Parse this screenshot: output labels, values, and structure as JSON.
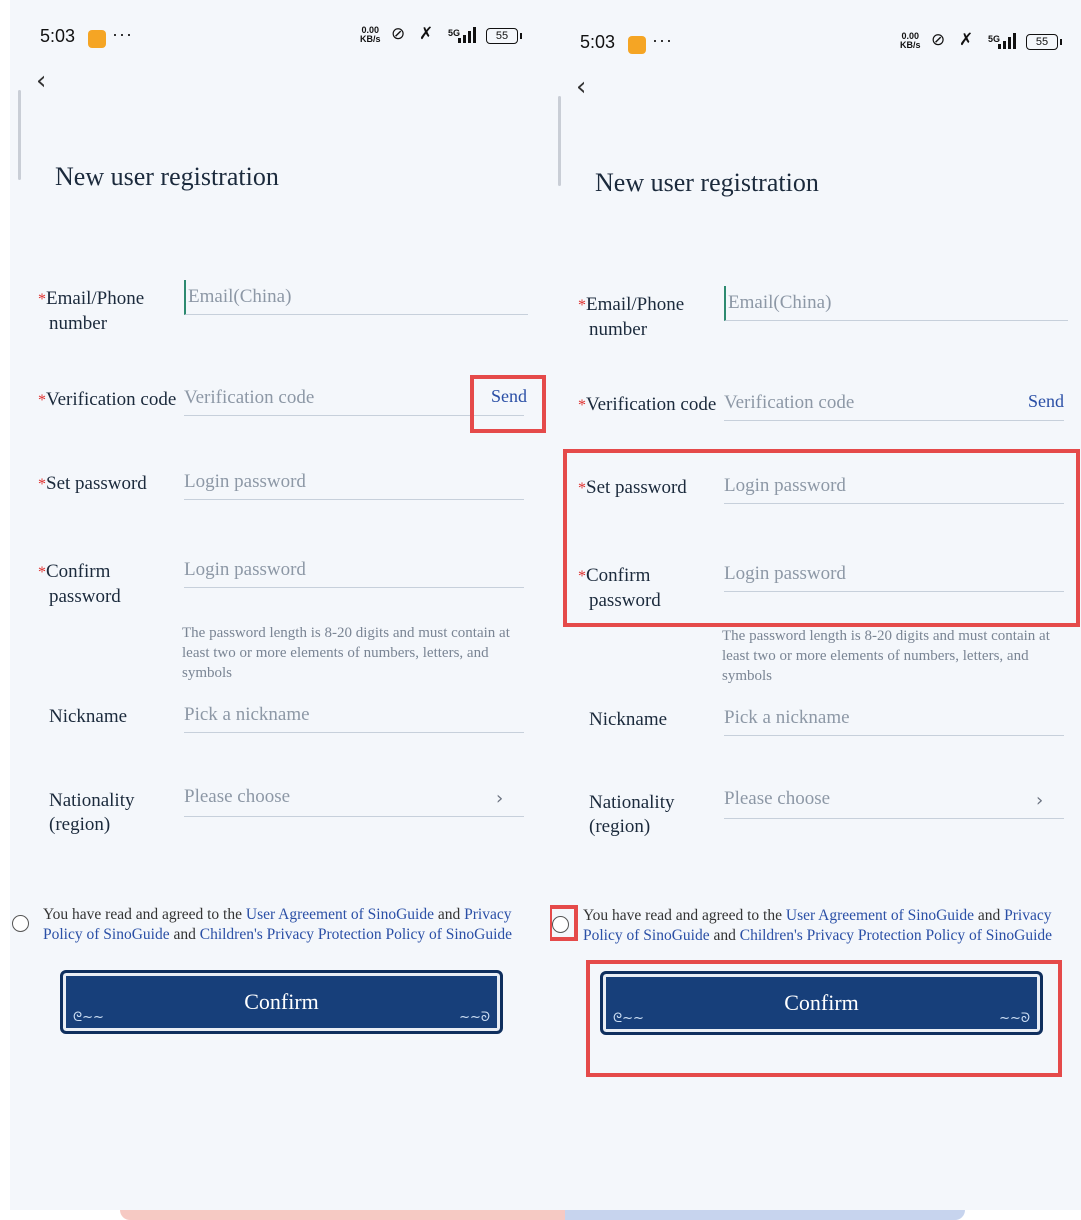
{
  "status_bar": {
    "time": "5:03",
    "dots": "···",
    "net_speed_value": "0.00",
    "net_speed_unit": "KB/s",
    "network": "5G",
    "battery": "55"
  },
  "page": {
    "title": "New user registration",
    "required_marker": "*",
    "email_label_1": "Email/Phone",
    "email_label_2": "number",
    "email_placeholder": "Email(China)",
    "code_label": "Verification code",
    "code_placeholder": "Verification code",
    "send_label": "Send",
    "password_label": "Set password",
    "password_placeholder": "Login password",
    "confirm_label_1": "Confirm",
    "confirm_label_2": "password",
    "confirm_placeholder": "Login password",
    "password_hint": "The password length is 8-20 digits and must contain at least two or more elements of numbers, letters, and symbols",
    "nickname_label": "Nickname",
    "nickname_placeholder": "Pick a nickname",
    "nationality_label_1": "Nationality",
    "nationality_label_2": "(region)",
    "nationality_value": "Please choose",
    "agree_prefix": "You have read and agreed to the ",
    "user_agreement_link": "User Agreement of SinoGuide",
    "and_1": " and ",
    "privacy_link": "Privacy Policy of SinoGuide",
    "and_2": " and ",
    "children_link": "Children's Privacy Protection Policy of SinoGuide",
    "confirm_button": "Confirm"
  },
  "colors": {
    "highlight": "#e54a4a",
    "button": "#173f7a",
    "link": "#2a4fa6"
  }
}
